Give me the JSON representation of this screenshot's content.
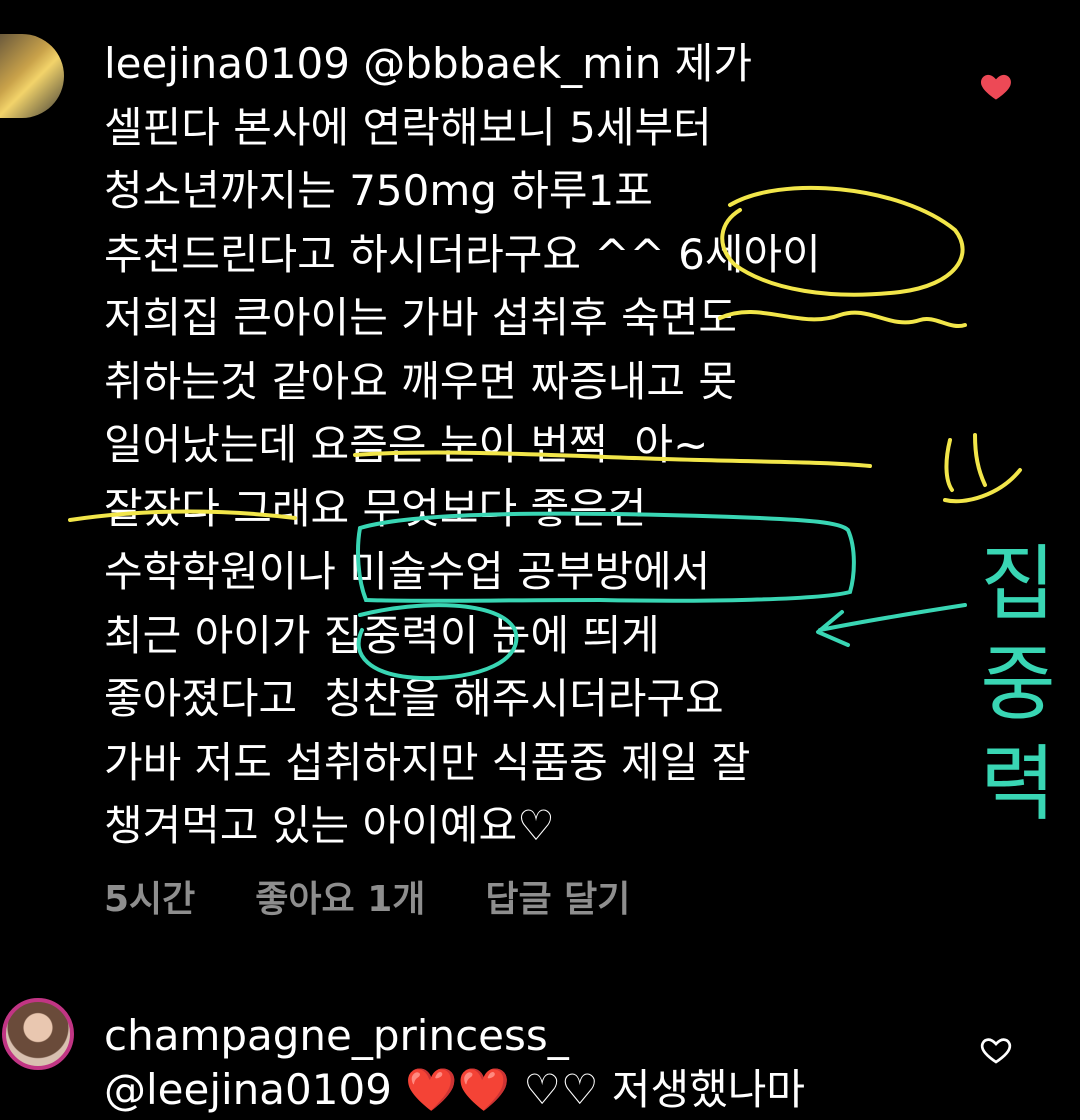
{
  "comment": {
    "username": "leejina0109",
    "mention": "@bbbaek_min",
    "body_lines": [
      " 제가",
      "셀핀다 본사에 연락해보니 5세부터",
      "청소년까지는 750mg 하루1포",
      "추천드린다고 하시더라구요 ^^ 6세아이",
      "저희집 큰아이는 가바 섭취후 숙면도",
      "취하는것 같아요 깨우면 짜증내고 못",
      "일어났는데 요즘은 눈이 번쩍  아~",
      "잘잤다 그래요 무엇보다 좋은건",
      "수학학원이나 미술수업 공부방에서",
      "최근 아이가 집중력이 눈에 띄게",
      "좋아졌다고  칭찬을 해주시더라구요",
      "가바 저도 섭취하지만 식품중 제일 잘",
      "챙겨먹고 있는 아이예요♡"
    ],
    "time": "5시간",
    "likes": "좋아요 1개",
    "reply": "답글 달기"
  },
  "next_comment": {
    "username": "champagne_princess_",
    "partial_line": "@leejina0109 ❤️❤️ ♡♡ 저생했나마"
  },
  "annotation": {
    "handwritten_text": "집중력"
  },
  "colors": {
    "background": "#000000",
    "text": "#ffffff",
    "meta": "#8e8e8e",
    "like": "#ed4956",
    "highlight_yellow": "#f2e64a",
    "highlight_teal": "#39d6b4"
  },
  "icons": {
    "like": "heart-filled-icon",
    "like_empty": "heart-outline-icon"
  }
}
